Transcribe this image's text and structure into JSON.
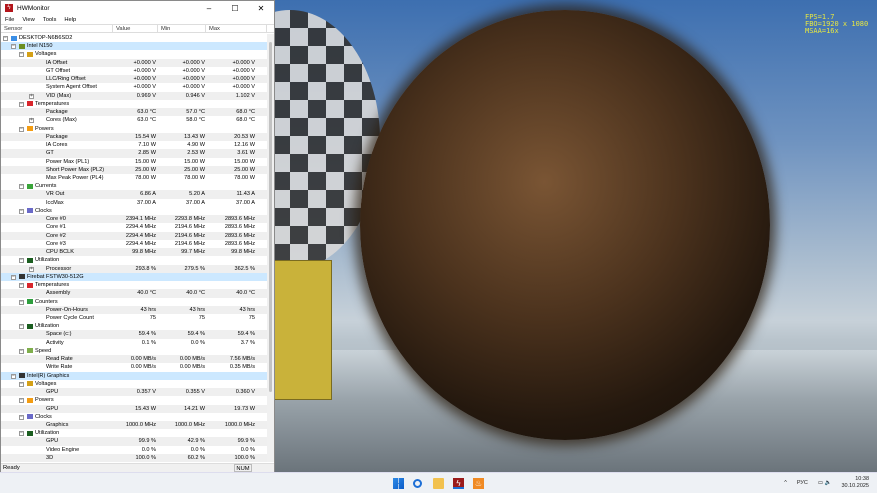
{
  "window": {
    "title": "HWMonitor",
    "menu": [
      "File",
      "View",
      "Tools",
      "Help"
    ],
    "columns": [
      "Sensor",
      "Value",
      "Min",
      "Max"
    ],
    "status": "Ready",
    "num": "NUM"
  },
  "hud": [
    "FPS=1.7",
    "FBO=1920 x 1080",
    "MSAA=16x"
  ],
  "rows": [
    [
      "DESKTOP-N6B6SD2",
      "",
      "",
      "",
      0,
      "pc"
    ],
    [
      "Intel N150",
      "",
      "",
      "",
      1,
      "cpu"
    ],
    [
      "Voltages",
      "",
      "",
      "",
      2,
      "volt"
    ],
    [
      "IA Offset",
      "+0.000 V",
      "+0.000 V",
      "+0.000 V",
      3,
      ""
    ],
    [
      "GT Offset",
      "+0.000 V",
      "+0.000 V",
      "+0.000 V",
      3,
      ""
    ],
    [
      "LLC/Ring Offset",
      "+0.000 V",
      "+0.000 V",
      "+0.000 V",
      3,
      ""
    ],
    [
      "System Agent Offset",
      "+0.000 V",
      "+0.000 V",
      "+0.000 V",
      3,
      ""
    ],
    [
      "VID (Max)",
      "0.969 V",
      "0.946 V",
      "1.102 V",
      3,
      "x"
    ],
    [
      "Temperatures",
      "",
      "",
      "",
      2,
      "temp"
    ],
    [
      "Package",
      "63.0 °C",
      "57.0 °C",
      "68.0 °C",
      3,
      ""
    ],
    [
      "Cores (Max)",
      "63.0 °C",
      "58.0 °C",
      "68.0 °C",
      3,
      "x"
    ],
    [
      "Powers",
      "",
      "",
      "",
      2,
      "power"
    ],
    [
      "Package",
      "15.54 W",
      "13.43 W",
      "20.53 W",
      3,
      ""
    ],
    [
      "IA Cores",
      "7.10 W",
      "4.90 W",
      "12.16 W",
      3,
      ""
    ],
    [
      "GT",
      "2.85 W",
      "2.53 W",
      "3.61 W",
      3,
      ""
    ],
    [
      "Power Max (PL1)",
      "15.00 W",
      "15.00 W",
      "15.00 W",
      3,
      ""
    ],
    [
      "Short Power Max (PL2)",
      "25.00 W",
      "25.00 W",
      "25.00 W",
      3,
      ""
    ],
    [
      "Max Peak Power (PL4)",
      "78.00 W",
      "78.00 W",
      "78.00 W",
      3,
      ""
    ],
    [
      "Currents",
      "",
      "",
      "",
      2,
      "current"
    ],
    [
      "VR Out",
      "6.86 A",
      "5.20 A",
      "11.43 A",
      3,
      ""
    ],
    [
      "IccMax",
      "37.00 A",
      "37.00 A",
      "37.00 A",
      3,
      ""
    ],
    [
      "Clocks",
      "",
      "",
      "",
      2,
      "clock"
    ],
    [
      "Core #0",
      "2394.1 MHz",
      "2293.8 MHz",
      "2893.6 MHz",
      3,
      ""
    ],
    [
      "Core #1",
      "2294.4 MHz",
      "2194.6 MHz",
      "2893.6 MHz",
      3,
      ""
    ],
    [
      "Core #2",
      "2294.4 MHz",
      "2194.6 MHz",
      "2893.6 MHz",
      3,
      ""
    ],
    [
      "Core #3",
      "2294.4 MHz",
      "2194.6 MHz",
      "2893.6 MHz",
      3,
      ""
    ],
    [
      "CPU BCLK",
      "99.8 MHz",
      "99.7 MHz",
      "99.8 MHz",
      3,
      ""
    ],
    [
      "Utilization",
      "",
      "",
      "",
      2,
      "util"
    ],
    [
      "Processor",
      "293.8 %",
      "279.5 %",
      "362.5 %",
      3,
      "x"
    ],
    [
      "Firebat FSTW30-512G",
      "",
      "",
      "",
      1,
      "disk"
    ],
    [
      "Temperatures",
      "",
      "",
      "",
      2,
      "temp"
    ],
    [
      "Assembly",
      "40.0 °C",
      "40.0 °C",
      "40.0 °C",
      3,
      ""
    ],
    [
      "Counters",
      "",
      "",
      "",
      2,
      "counter"
    ],
    [
      "Power-On-Hours",
      "43 hrs",
      "43 hrs",
      "43 hrs",
      3,
      ""
    ],
    [
      "Power Cycle Count",
      "75",
      "75",
      "75",
      3,
      ""
    ],
    [
      "Utilization",
      "",
      "",
      "",
      2,
      "util"
    ],
    [
      "Space (c:)",
      "59.4 %",
      "59.4 %",
      "59.4 %",
      3,
      ""
    ],
    [
      "Activity",
      "0.1 %",
      "0.0 %",
      "3.7 %",
      3,
      ""
    ],
    [
      "Speed",
      "",
      "",
      "",
      2,
      "speed"
    ],
    [
      "Read Rate",
      "0.00 MB/s",
      "0.00 MB/s",
      "7.56 MB/s",
      3,
      ""
    ],
    [
      "Write Rate",
      "0.00 MB/s",
      "0.00 MB/s",
      "0.35 MB/s",
      3,
      ""
    ],
    [
      "Intel(R) Graphics",
      "",
      "",
      "",
      1,
      "gpu"
    ],
    [
      "Voltages",
      "",
      "",
      "",
      2,
      "volt"
    ],
    [
      "GPU",
      "0.357 V",
      "0.355 V",
      "0.360 V",
      3,
      ""
    ],
    [
      "Powers",
      "",
      "",
      "",
      2,
      "power"
    ],
    [
      "GPU",
      "15.43 W",
      "14.21 W",
      "19.73 W",
      3,
      ""
    ],
    [
      "Clocks",
      "",
      "",
      "",
      2,
      "clock"
    ],
    [
      "Graphics",
      "1000.0 MHz",
      "1000.0 MHz",
      "1000.0 MHz",
      3,
      ""
    ],
    [
      "Utilization",
      "",
      "",
      "",
      2,
      "util"
    ],
    [
      "GPU",
      "99.9 %",
      "42.9 %",
      "99.9 %",
      3,
      ""
    ],
    [
      "Video Engine",
      "0.0 %",
      "0.0 %",
      "0.0 %",
      3,
      ""
    ],
    [
      "3D",
      "100.0 %",
      "60.2 %",
      "100.0 %",
      3,
      ""
    ]
  ],
  "tray": {
    "lang": "РУС",
    "time": "10:38",
    "date": "30.10.2025"
  },
  "colors": {
    "accent": "#cce8ff",
    "hud": "#e8e840",
    "hwmonitor": "#b3151b"
  }
}
